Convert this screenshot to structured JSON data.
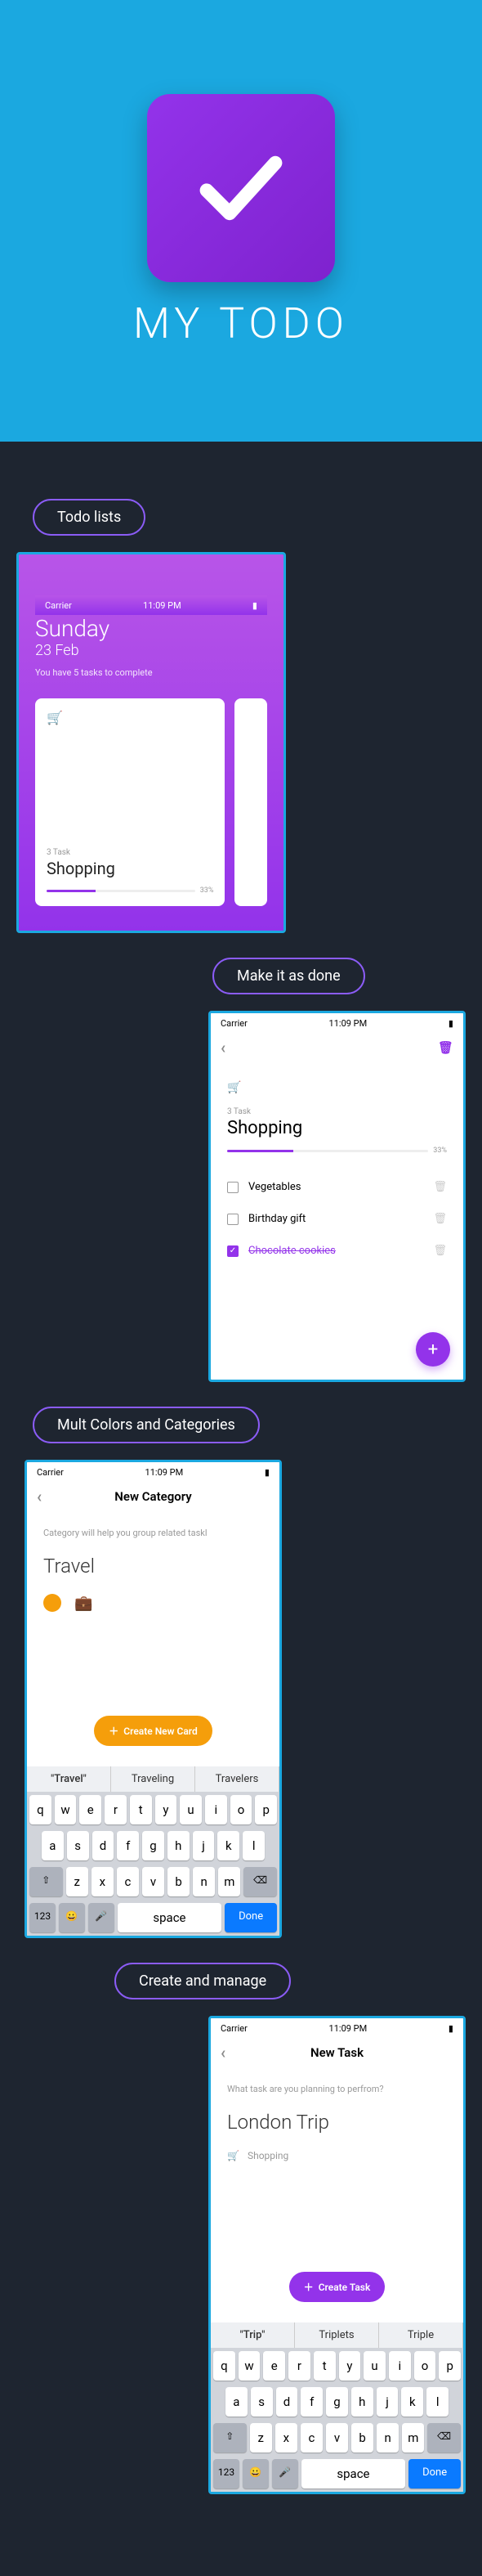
{
  "hero": {
    "title": "MY TODO"
  },
  "sections": {
    "s1": "Todo lists",
    "s2": "Make it as done",
    "s3": "Mult Colors and Categories",
    "s4": "Create and manage"
  },
  "status": {
    "carrier": "Carrier",
    "time": "11:09 PM"
  },
  "home": {
    "day": "Sunday",
    "date": "23 Feb",
    "subtitle": "You have 5 tasks to complete",
    "card": {
      "meta": "3 Task",
      "title": "Shopping",
      "pct": "33%"
    }
  },
  "detail": {
    "meta": "3 Task",
    "title": "Shopping",
    "pct": "33%",
    "tasks": [
      {
        "name": "Vegetables",
        "done": false
      },
      {
        "name": "Birthday gift",
        "done": false
      },
      {
        "name": "Chocolate cookies",
        "done": true
      }
    ]
  },
  "newcat": {
    "title": "New Category",
    "hint": "Category will help you group related taskl",
    "input": "Travel",
    "cta": "Create New Card",
    "suggestions": [
      "\"Travel\"",
      "Traveling",
      "Travelers"
    ]
  },
  "newtask": {
    "title": "New Task",
    "hint": "What task are you planning to perfrom?",
    "input": "London Trip",
    "assoc": "Shopping",
    "cta": "Create Task",
    "suggestions": [
      "\"Trip\"",
      "Triplets",
      "Triple"
    ]
  },
  "keyboard": {
    "r1": [
      "q",
      "w",
      "e",
      "r",
      "t",
      "y",
      "u",
      "i",
      "o",
      "p"
    ],
    "r2": [
      "a",
      "s",
      "d",
      "f",
      "g",
      "h",
      "j",
      "k",
      "l"
    ],
    "r3": [
      "z",
      "x",
      "c",
      "v",
      "b",
      "n",
      "m"
    ],
    "shift": "⇧",
    "bksp": "⌫",
    "num": "123",
    "emoji": "😀",
    "mic": "🎤",
    "space": "space",
    "done": "Done"
  }
}
